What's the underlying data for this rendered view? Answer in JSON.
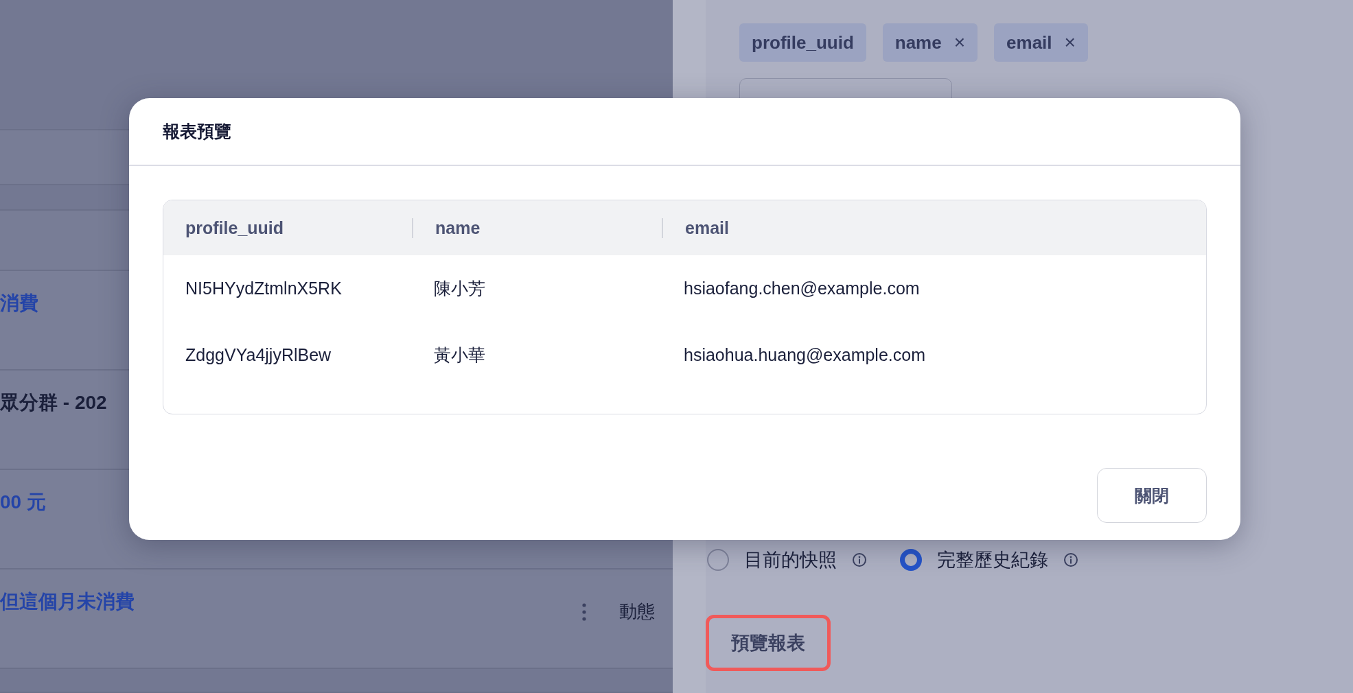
{
  "list_rows": [
    {
      "kind": "link",
      "text": "消費"
    },
    {
      "kind": "title",
      "text": "眾分群 - 202"
    },
    {
      "kind": "link",
      "text": "00 元"
    },
    {
      "kind": "link",
      "text": "但這個月未消費",
      "type_label": "動態"
    }
  ],
  "column_tags": [
    {
      "label": "profile_uuid"
    },
    {
      "label": "name",
      "remove_icon": "×"
    },
    {
      "label": "email",
      "remove_icon": "×"
    }
  ],
  "report_mode": [
    {
      "label": "目前的快照",
      "selected": false
    },
    {
      "label": "完整歷史紀錄",
      "selected": true
    }
  ],
  "preview_button": {
    "label": "預覽報表",
    "highlighted": true
  },
  "dialog": {
    "title": "報表預覽",
    "table": {
      "columns": [
        "profile_uuid",
        "name",
        "email"
      ],
      "rows": [
        [
          "NI5HYydZtmlnX5RK",
          "陳小芳",
          "hsiaofang.chen@example.com"
        ],
        [
          "ZdggVYa4jjyRlBew",
          "黃小華",
          "hsiaohua.huang@example.com"
        ]
      ]
    },
    "close_button": "關閉"
  }
}
